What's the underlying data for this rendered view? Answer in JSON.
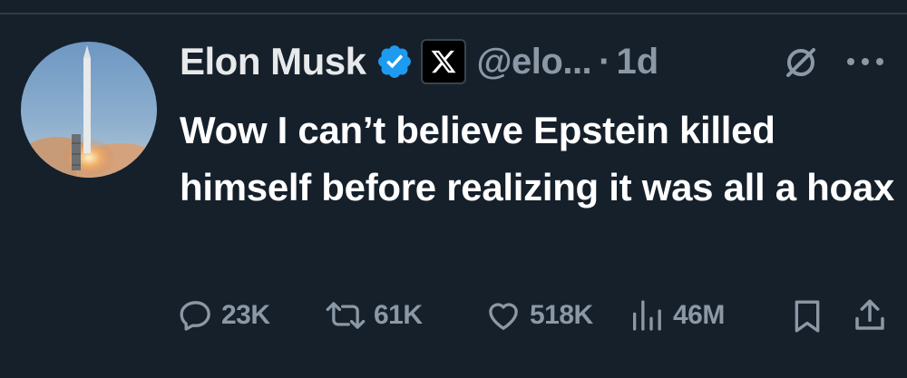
{
  "tweet": {
    "author_name": "Elon Musk",
    "handle": "@elo...",
    "separator": "·",
    "time": "1d",
    "text": "Wow I can’t believe Epstein killed himself before realizing it was all a hoax"
  },
  "icons": {
    "verified": "verified-badge-icon",
    "affiliation": "x-logo-icon",
    "grok": "grok-icon",
    "more": "more-icon",
    "reply": "reply-icon",
    "retweet": "retweet-icon",
    "like": "heart-icon",
    "views": "views-icon",
    "bookmark": "bookmark-icon",
    "share": "share-icon"
  },
  "actions": {
    "replies": "23K",
    "retweets": "61K",
    "likes": "518K",
    "views": "46M"
  },
  "colors": {
    "background": "#15202b",
    "verified": "#1d9bf0",
    "muted": "#8b98a5",
    "text": "#ffffff"
  }
}
